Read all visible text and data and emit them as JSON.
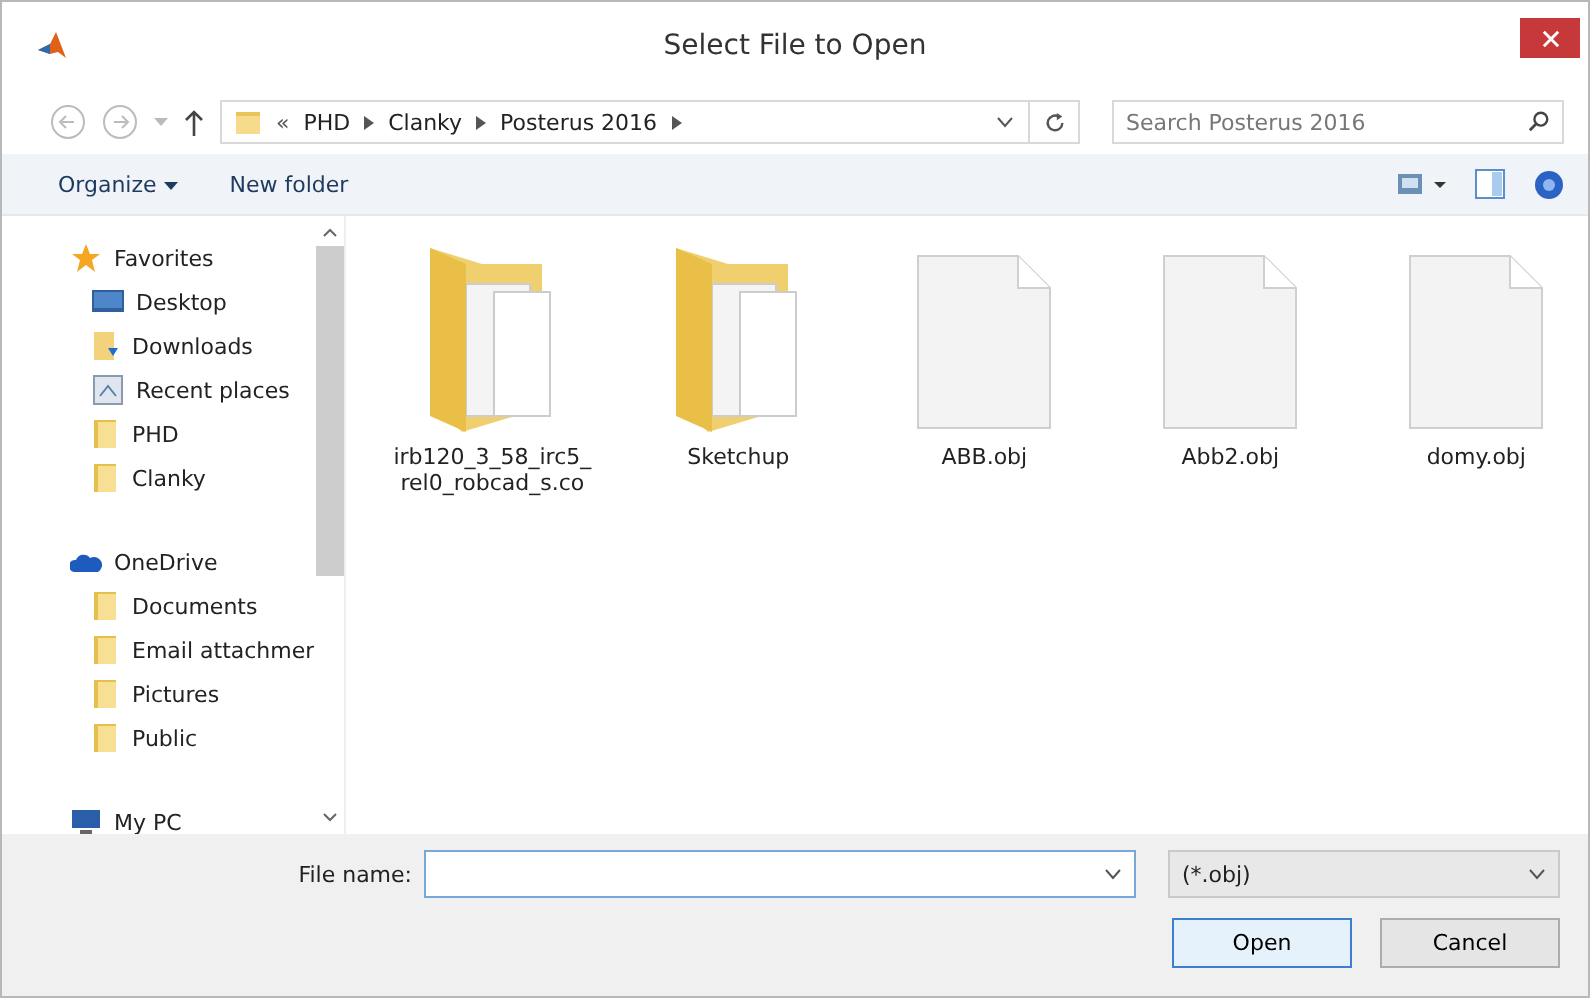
{
  "window": {
    "title": "Select File to Open"
  },
  "address": {
    "crumbs": [
      "PHD",
      "Clanky",
      "Posterus 2016"
    ],
    "overflow": "«"
  },
  "search": {
    "placeholder": "Search Posterus 2016"
  },
  "toolbar": {
    "organize": "Organize",
    "new_folder": "New folder"
  },
  "sidebar": {
    "sections": [
      {
        "label": "Favorites",
        "kind": "star",
        "children": [
          {
            "label": "Desktop",
            "kind": "desktop"
          },
          {
            "label": "Downloads",
            "kind": "download"
          },
          {
            "label": "Recent places",
            "kind": "recent"
          },
          {
            "label": "PHD",
            "kind": "folder"
          },
          {
            "label": "Clanky",
            "kind": "folder"
          }
        ]
      },
      {
        "label": "OneDrive",
        "kind": "cloud",
        "children": [
          {
            "label": "Documents",
            "kind": "folder"
          },
          {
            "label": "Email attachmer",
            "kind": "folder"
          },
          {
            "label": "Pictures",
            "kind": "folder"
          },
          {
            "label": "Public",
            "kind": "folder"
          }
        ]
      },
      {
        "label": "My PC",
        "kind": "pc"
      }
    ]
  },
  "files": [
    {
      "name": "irb120_3_58_irc5_rel0_robcad_s.co",
      "kind": "folder"
    },
    {
      "name": "Sketchup",
      "kind": "folder"
    },
    {
      "name": "ABB.obj",
      "kind": "file"
    },
    {
      "name": "Abb2.obj",
      "kind": "file"
    },
    {
      "name": "domy.obj",
      "kind": "file"
    }
  ],
  "footer": {
    "file_name_label": "File name:",
    "file_type": "(*.obj)",
    "open": "Open",
    "cancel": "Cancel"
  }
}
